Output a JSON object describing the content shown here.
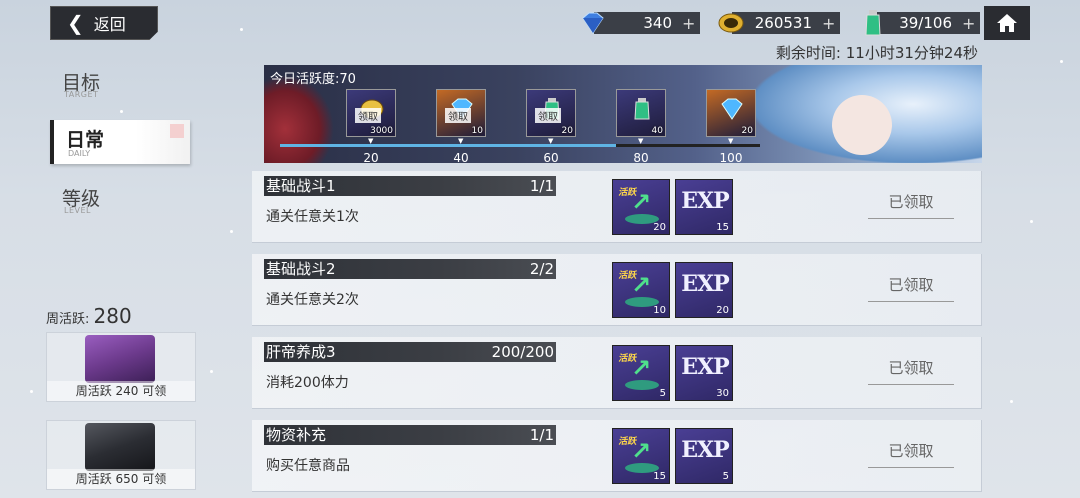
{
  "header": {
    "back_label": "返回",
    "back_icon": "chevron-left-icon",
    "home_icon": "home-icon",
    "resources": [
      {
        "icon": "diamond-icon",
        "value": "340"
      },
      {
        "icon": "coin-icon",
        "value": "260531"
      },
      {
        "icon": "stamina-flask-icon",
        "value": "39/106"
      }
    ],
    "plus_label": "+",
    "remaining_time": "剩余时间: 11小时31分钟24秒"
  },
  "sidebar": {
    "items": [
      {
        "label": "目标",
        "sub": "TARGET"
      },
      {
        "label": "日常",
        "sub": "DAILY"
      },
      {
        "label": "等级",
        "sub": "LEVEL"
      }
    ],
    "active_index": 1,
    "weekly_label": "周活跃:",
    "weekly_value": "280",
    "chests": [
      {
        "caption": "周活跃 240 可领",
        "color": "#6c3a8c"
      },
      {
        "caption": "周活跃 650 可领",
        "color": "#2b2d33"
      }
    ]
  },
  "banner": {
    "title": "今日活跃度:70",
    "progress_fraction": 0.7,
    "milestones": [
      {
        "threshold": "20",
        "count": "3000",
        "icon": "coin-icon",
        "claim": "领取",
        "bg": "#3c3a7a"
      },
      {
        "threshold": "40",
        "count": "10",
        "icon": "diamond-icon",
        "claim": "领取",
        "bg": "#c46a24"
      },
      {
        "threshold": "60",
        "count": "20",
        "icon": "stamina-flask-icon",
        "claim": "领取",
        "bg": "#3c3a7a"
      },
      {
        "threshold": "80",
        "count": "40",
        "icon": "stamina-flask-icon",
        "claim": "",
        "bg": "#3c3a7a"
      },
      {
        "threshold": "100",
        "count": "20",
        "icon": "diamond-icon",
        "claim": "",
        "bg": "#c46a24"
      }
    ]
  },
  "tasks": [
    {
      "title": "基础战斗1",
      "progress": "1/1",
      "desc": "通关任意关1次",
      "activity": "20",
      "exp": "15",
      "status": "已领取"
    },
    {
      "title": "基础战斗2",
      "progress": "2/2",
      "desc": "通关任意关2次",
      "activity": "10",
      "exp": "20",
      "status": "已领取"
    },
    {
      "title": "肝帝养成3",
      "progress": "200/200",
      "desc": "消耗200体力",
      "activity": "5",
      "exp": "30",
      "status": "已领取"
    },
    {
      "title": "物资补充",
      "progress": "1/1",
      "desc": "购买任意商品",
      "activity": "15",
      "exp": "5",
      "status": "已领取"
    }
  ],
  "reward_labels": {
    "activity": "活跃",
    "exp": "EXP"
  }
}
